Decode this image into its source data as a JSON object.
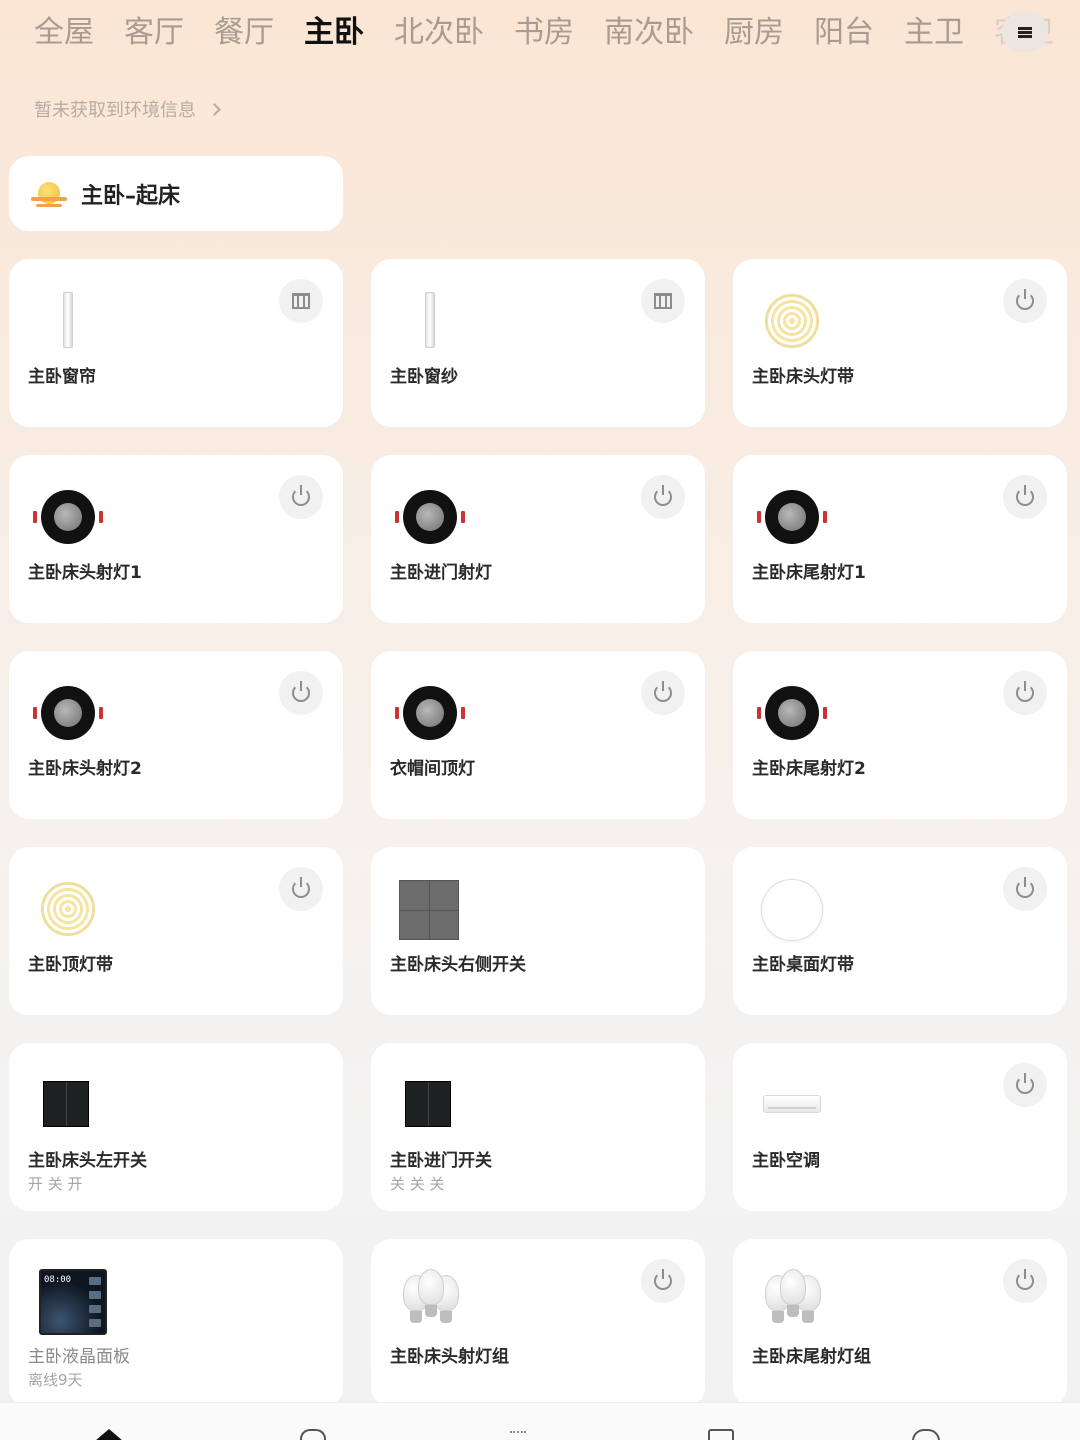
{
  "room_tabs": [
    "全屋",
    "客厅",
    "餐厅",
    "主卧",
    "北次卧",
    "书房",
    "南次卧",
    "厨房",
    "阳台",
    "主卫",
    "客卫"
  ],
  "active_tab": "主卧",
  "environment_text": "暂未获取到环境信息",
  "scene": {
    "label": "主卧–起床",
    "icon": "sunrise-icon"
  },
  "devices": [
    {
      "name": "主卧窗帘",
      "icon": "curtain-icon",
      "action": "curtain-control-icon"
    },
    {
      "name": "主卧窗纱",
      "icon": "curtain-icon",
      "action": "curtain-control-icon"
    },
    {
      "name": "主卧床头灯带",
      "icon": "light-strip-icon",
      "action": "power-icon"
    },
    {
      "name": "主卧床头射灯1",
      "icon": "spotlight-icon",
      "action": "power-icon"
    },
    {
      "name": "主卧进门射灯",
      "icon": "spotlight-icon",
      "action": "power-icon"
    },
    {
      "name": "主卧床尾射灯1",
      "icon": "spotlight-icon",
      "action": "power-icon"
    },
    {
      "name": "主卧床头射灯2",
      "icon": "spotlight-icon",
      "action": "power-icon"
    },
    {
      "name": "衣帽间顶灯",
      "icon": "spotlight-icon",
      "action": "power-icon"
    },
    {
      "name": "主卧床尾射灯2",
      "icon": "spotlight-icon",
      "action": "power-icon"
    },
    {
      "name": "主卧顶灯带",
      "icon": "light-strip-icon",
      "action": "power-icon"
    },
    {
      "name": "主卧床头右侧开关",
      "icon": "wall-switch-gray-icon",
      "action": ""
    },
    {
      "name": "主卧桌面灯带",
      "icon": "round-lamp-icon",
      "action": "power-icon"
    },
    {
      "name": "主卧床头左开关",
      "status": "开 关 开",
      "icon": "wall-switch-dark-icon",
      "action": ""
    },
    {
      "name": "主卧进门开关",
      "status": "关 关 关",
      "icon": "wall-switch-dark-icon",
      "action": ""
    },
    {
      "name": "主卧空调",
      "icon": "air-conditioner-icon",
      "action": "power-icon"
    },
    {
      "name": "主卧液晶面板",
      "status": "离线9天",
      "icon": "lcd-panel-icon",
      "action": "",
      "offline": true,
      "screen_time": "08:00"
    },
    {
      "name": "主卧床头射灯组",
      "icon": "bulb-group-icon",
      "action": "power-icon"
    },
    {
      "name": "主卧床尾射灯组",
      "icon": "bulb-group-icon",
      "action": "power-icon"
    }
  ],
  "bottom_nav": [
    "home-icon",
    "house-icon",
    "sparkle-icon",
    "grid-icon",
    "profile-icon"
  ],
  "colors": {
    "background_top": "#fbe6d4",
    "card": "#ffffff",
    "muted_text": "#a6a6a6"
  }
}
